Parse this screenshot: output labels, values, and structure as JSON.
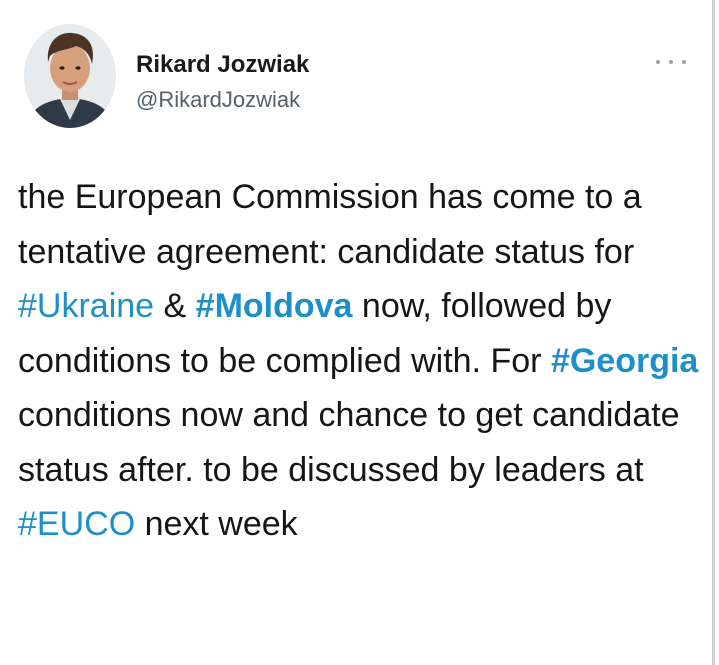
{
  "author": {
    "display_name": "Rikard Jozwiak",
    "handle": "@RikardJozwiak",
    "avatar_icon": "profile-photo"
  },
  "menu": {
    "more_icon": "more-horizontal-icon"
  },
  "tweet": {
    "seg1": "the European Commission has come to a tentative agreement: candidate status for ",
    "tag_ukraine": "#Ukraine",
    "seg2": " & ",
    "tag_moldova": "#Moldova",
    "seg3": " now, followed by conditions to be complied with. For ",
    "tag_georgia": "#Georgia",
    "seg4": " conditions now and chance to get candidate status after. to be discussed by leaders at ",
    "tag_euco": "#EUCO",
    "seg5": " next week"
  },
  "colors": {
    "hashtag": "#1d8fc9",
    "text": "#161616",
    "handle": "#55606a"
  }
}
